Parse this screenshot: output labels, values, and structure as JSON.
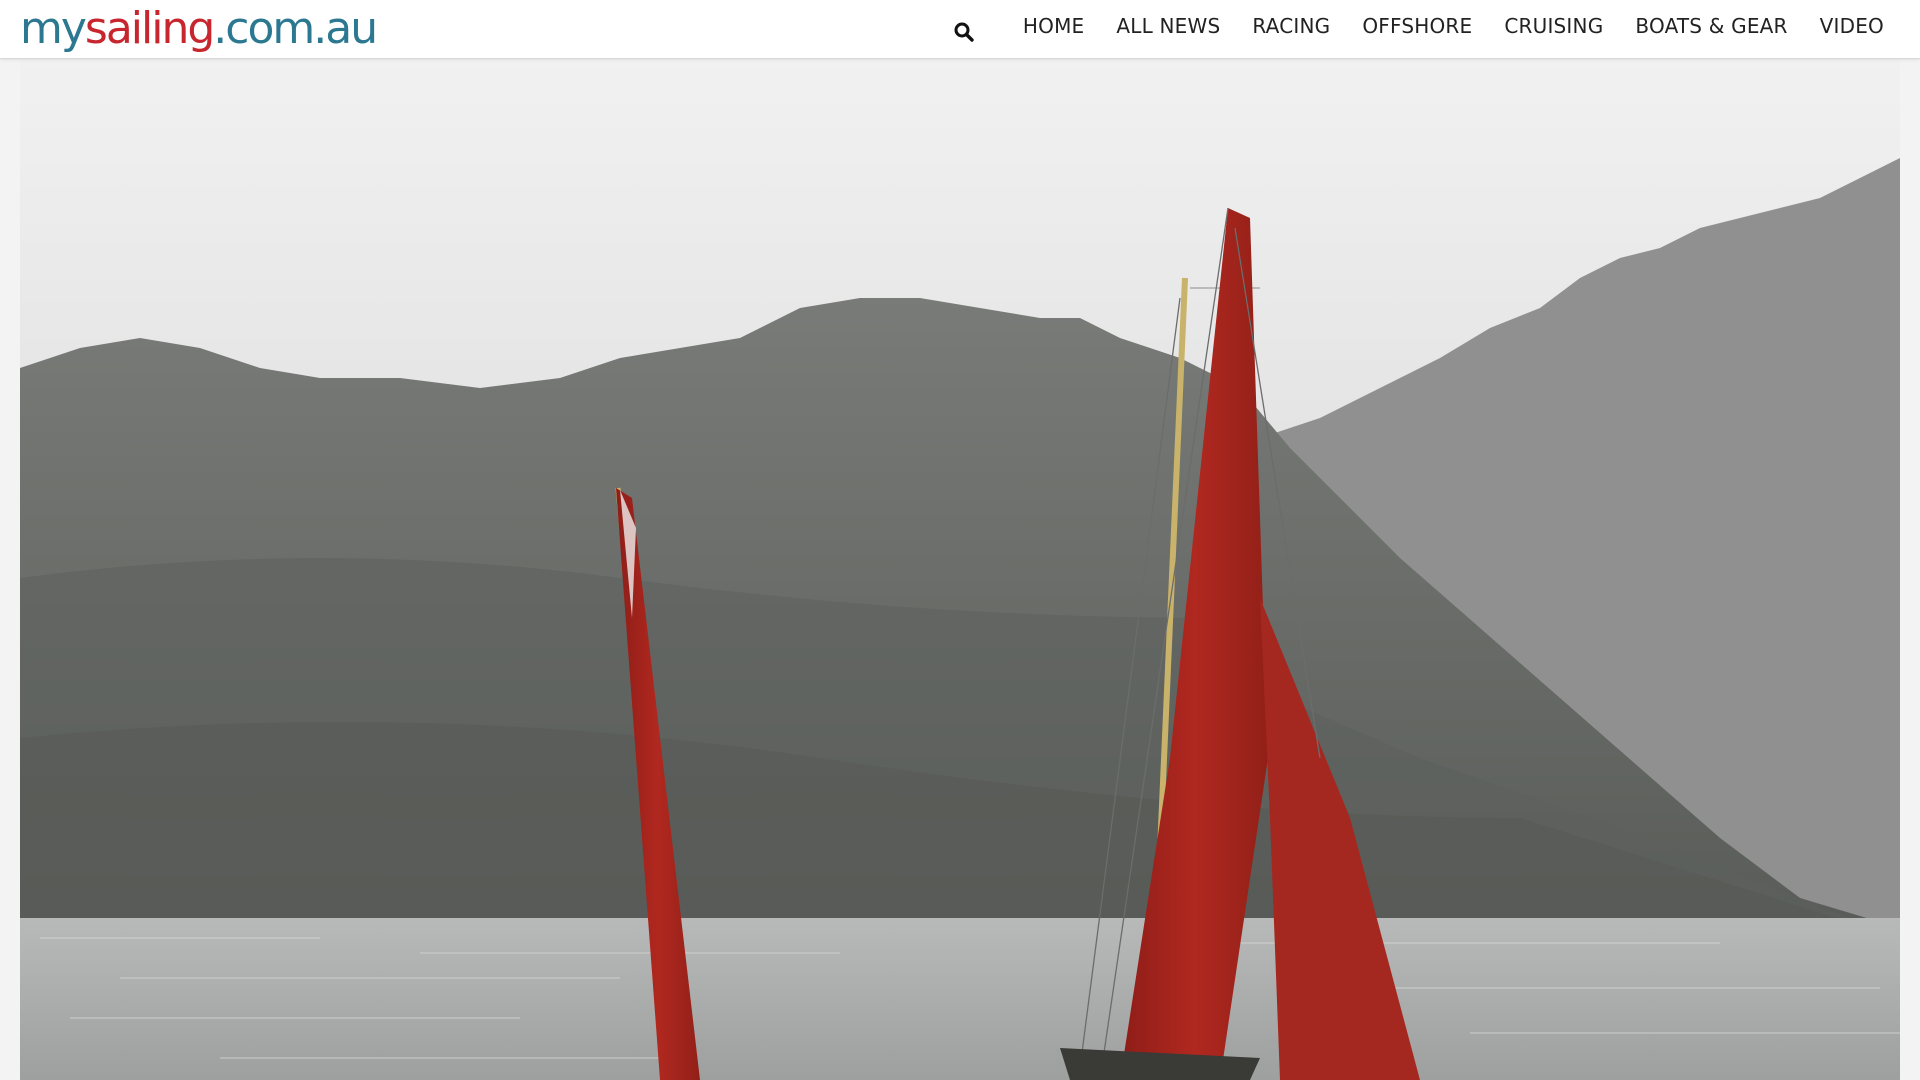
{
  "site": {
    "logo_part1": "my",
    "logo_part2": "sailing",
    "logo_part3": ".com.au"
  },
  "header": {
    "search_icon": "search-icon",
    "nav": [
      {
        "label": "HOME"
      },
      {
        "label": "ALL NEWS"
      },
      {
        "label": "RACING"
      },
      {
        "label": "OFFSHORE"
      },
      {
        "label": "CRUISING"
      },
      {
        "label": "BOATS & GEAR"
      },
      {
        "label": "VIDEO"
      }
    ]
  },
  "colors": {
    "brand_blue": "#2c7891",
    "brand_red": "#c7262e",
    "sail_red": "#a8251e"
  },
  "hero": {
    "image_subject": "red-sailed-boat-near-mountains"
  }
}
